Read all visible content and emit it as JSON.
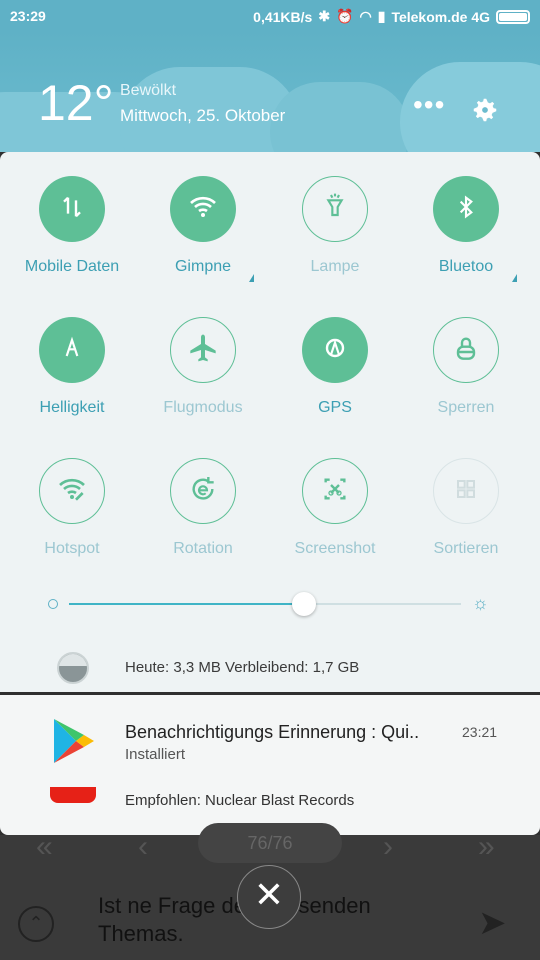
{
  "status": {
    "time": "23:29",
    "speed": "0,41KB/s",
    "carrier": "Telekom.de 4G"
  },
  "weather": {
    "temp": "12°",
    "condition": "Bewölkt",
    "date": "Mittwoch, 25. Oktober"
  },
  "tiles": [
    {
      "label": "Mobile Daten",
      "icon": "mobile-data-icon",
      "state": "on"
    },
    {
      "label": "Gimpne",
      "icon": "wifi-icon",
      "state": "on",
      "dropdown": true
    },
    {
      "label": "Lampe",
      "icon": "flashlight-icon",
      "state": "off"
    },
    {
      "label": "Bluetoo",
      "icon": "bluetooth-icon",
      "state": "on",
      "dropdown": true
    },
    {
      "label": "Helligkeit",
      "icon": "brightness-auto-icon",
      "state": "on"
    },
    {
      "label": "Flugmodus",
      "icon": "airplane-icon",
      "state": "off"
    },
    {
      "label": "GPS",
      "icon": "gps-icon",
      "state": "on"
    },
    {
      "label": "Sperren",
      "icon": "lock-icon",
      "state": "off"
    },
    {
      "label": "Hotspot",
      "icon": "hotspot-icon",
      "state": "off"
    },
    {
      "label": "Rotation",
      "icon": "rotation-icon",
      "state": "off"
    },
    {
      "label": "Screenshot",
      "icon": "screenshot-icon",
      "state": "off"
    },
    {
      "label": "Sortieren",
      "icon": "sort-icon",
      "state": "dim"
    }
  ],
  "brightness": {
    "level": 0.6
  },
  "data_usage": {
    "text": "Heute: 3,3 MB Verbleibend: 1,7 GB"
  },
  "notifications": [
    {
      "title": "Benachrichtigungs Erinnerung : Qui..",
      "subtitle": "Installiert",
      "time": "23:21",
      "icon": "play-store-icon"
    },
    {
      "title": "Empfohlen: Nuclear Blast Records",
      "icon": "youtube-icon"
    }
  ],
  "background_app": {
    "page": "76/76",
    "message": "Ist ne Frage des passenden Themas."
  },
  "colors": {
    "accent": "#5ebf96",
    "header": "#5fb1c6",
    "panel": "#eef3f4"
  }
}
